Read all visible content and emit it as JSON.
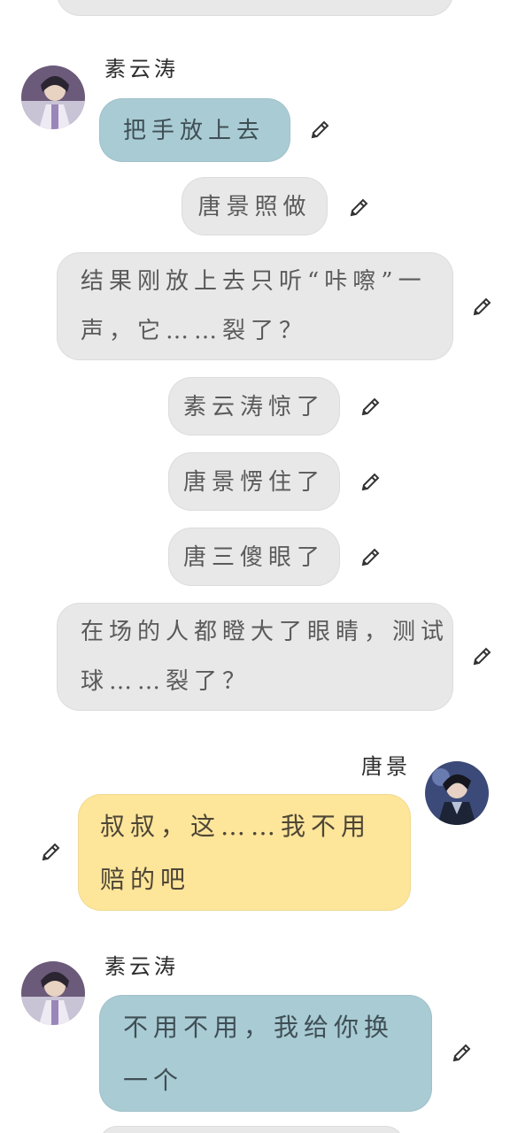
{
  "messages": [
    {
      "speaker": "",
      "text": ""
    },
    {
      "speaker": "素云涛",
      "text": "把手放上去"
    },
    {
      "text": "唐景照做"
    },
    {
      "text_line1": "结果刚放上去只听“咔嚓”一",
      "text_line2": "声，它……裂了？"
    },
    {
      "text": "素云涛惊了"
    },
    {
      "text": "唐景愣住了"
    },
    {
      "text": "唐三傻眼了"
    },
    {
      "text_line1": "在场的人都瞪大了眼睛，测试",
      "text_line2": "球……裂了？"
    },
    {
      "speaker": "唐景",
      "text_line1": "叔叔，这……我不用",
      "text_line2": "赔的吧"
    },
    {
      "speaker": "素云涛",
      "text_line1": "不用不用，我给你换",
      "text_line2": "一个"
    }
  ],
  "icons": {
    "edit": "pencil-icon",
    "avatar_suyuntao": "avatar-suyuntao",
    "avatar_tangjing": "avatar-tangjing"
  },
  "colors": {
    "gray_bubble": "#e8e8e8",
    "blue_bubble": "#a9cbd4",
    "yellow_bubble": "#fde59a"
  }
}
